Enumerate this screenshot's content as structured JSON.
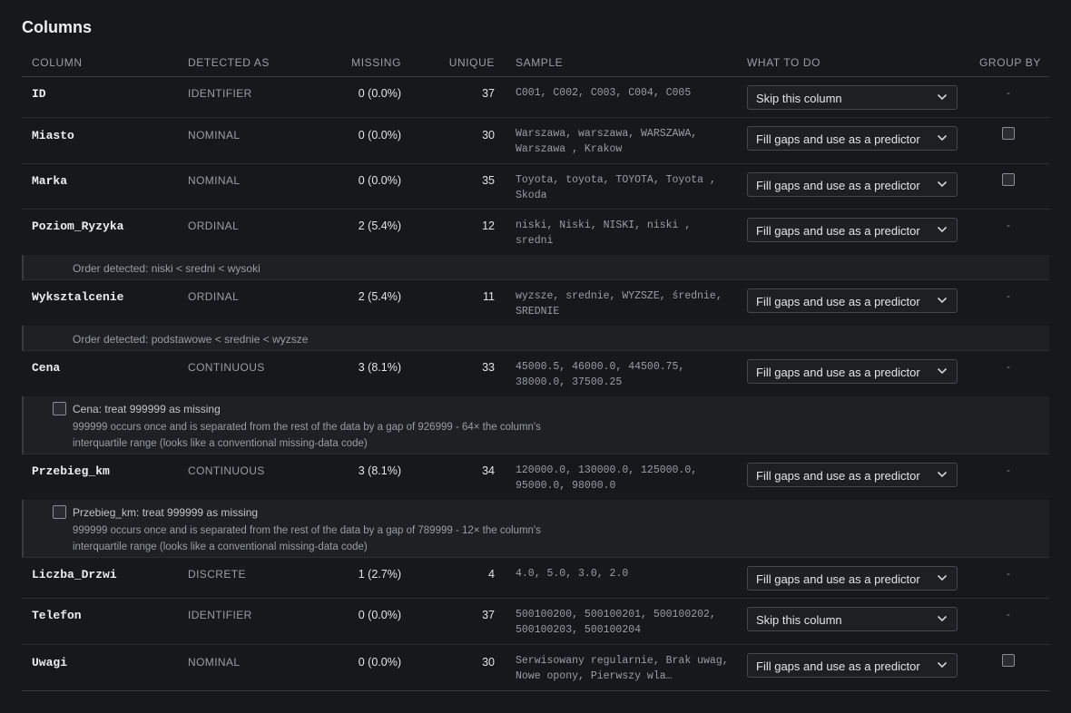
{
  "title": "Columns",
  "headers": {
    "column": "COLUMN",
    "detected_as": "DETECTED AS",
    "missing": "MISSING",
    "unique": "UNIQUE",
    "sample": "SAMPLE",
    "what_to_do": "WHAT TO DO",
    "group_by": "GROUP BY"
  },
  "rows": [
    {
      "name": "ID",
      "type": "IDENTIFIER",
      "missing": "0 (0.0%)",
      "unique": "37",
      "sample": "C001, C002, C003, C004, C005",
      "action": "Skip this column",
      "group": "-"
    },
    {
      "name": "Miasto",
      "type": "NOMINAL",
      "missing": "0 (0.0%)",
      "unique": "30",
      "sample": "Warszawa, warszawa, WARSZAWA, Warszawa , Krakow",
      "action": "Fill gaps and use as a predictor",
      "group": ""
    },
    {
      "name": "Marka",
      "type": "NOMINAL",
      "missing": "0 (0.0%)",
      "unique": "35",
      "sample": "Toyota, toyota, TOYOTA, Toyota , Skoda",
      "action": "Fill gaps and use as a predictor",
      "group": ""
    },
    {
      "name": "Poziom_Ryzyka",
      "type": "ORDINAL",
      "missing": "2 (5.4%)",
      "unique": "12",
      "sample": "niski, Niski, NISKI, niski , sredni",
      "action": "Fill gaps and use as a predictor",
      "group": "-",
      "note": "Order detected: niski < sredni < wysoki"
    },
    {
      "name": "Wyksztalcenie",
      "type": "ORDINAL",
      "missing": "2 (5.4%)",
      "unique": "11",
      "sample": "wyzsze, srednie, WYZSZE, średnie, SREDNIE",
      "action": "Fill gaps and use as a predictor",
      "group": "-",
      "note": "Order detected: podstawowe < srednie < wyzsze"
    },
    {
      "name": "Cena",
      "type": "CONTINUOUS",
      "missing": "3 (8.1%)",
      "unique": "33",
      "sample": "45000.5, 46000.0, 44500.75, 38000.0, 37500.25",
      "action": "Fill gaps and use as a predictor",
      "group": "-",
      "option_label": "Cena: treat 999999 as missing",
      "option_desc": "999999 occurs once and is separated from the rest of the data by a gap of 926999 - 64× the column's interquartile range (looks like a conventional missing-data code)"
    },
    {
      "name": "Przebieg_km",
      "type": "CONTINUOUS",
      "missing": "3 (8.1%)",
      "unique": "34",
      "sample": "120000.0, 130000.0, 125000.0, 95000.0, 98000.0",
      "action": "Fill gaps and use as a predictor",
      "group": "-",
      "option_label": "Przebieg_km: treat 999999 as missing",
      "option_desc": "999999 occurs once and is separated from the rest of the data by a gap of 789999 - 12× the column's interquartile range (looks like a conventional missing-data code)"
    },
    {
      "name": "Liczba_Drzwi",
      "type": "DISCRETE",
      "missing": "1 (2.7%)",
      "unique": "4",
      "sample": "4.0, 5.0, 3.0, 2.0",
      "action": "Fill gaps and use as a predictor",
      "group": "-"
    },
    {
      "name": "Telefon",
      "type": "IDENTIFIER",
      "missing": "0 (0.0%)",
      "unique": "37",
      "sample": "500100200, 500100201, 500100202, 500100203, 500100204",
      "action": "Skip this column",
      "group": "-"
    },
    {
      "name": "Uwagi",
      "type": "NOMINAL",
      "missing": "0 (0.0%)",
      "unique": "30",
      "sample": "Serwisowany regularnie, Brak uwag, Nowe opony, Pierwszy wla…",
      "action": "Fill gaps and use as a predictor",
      "group": ""
    }
  ]
}
